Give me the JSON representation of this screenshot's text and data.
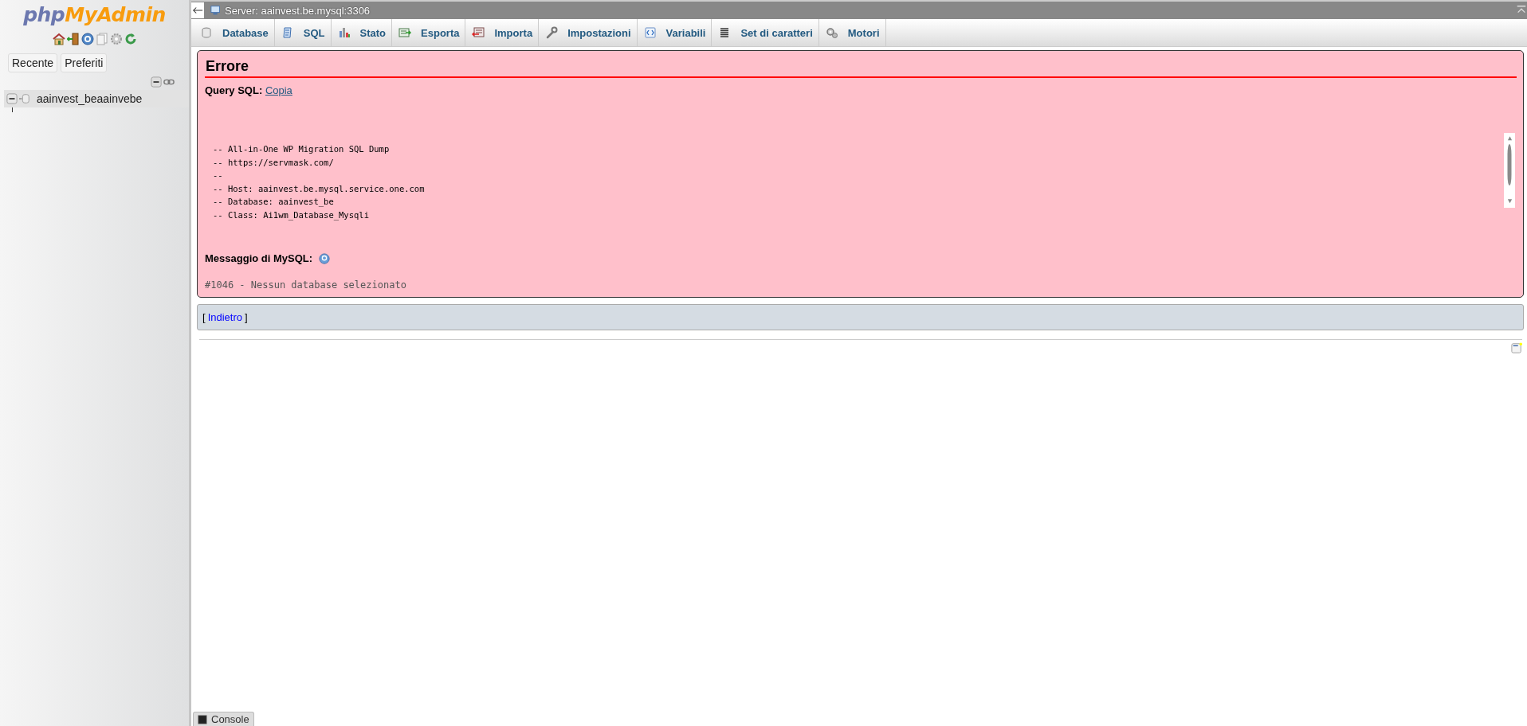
{
  "sidebar": {
    "logo": [
      "php",
      "MyAdmin"
    ],
    "buttons": [
      "Recente",
      "Preferiti"
    ],
    "tree": [
      {
        "label": "aainvest_beaainvebe",
        "expanded": true
      }
    ]
  },
  "topbar": {
    "title": "Server: aainvest.be.mysql:3306"
  },
  "tabs": [
    {
      "label": "Database",
      "kind": "database",
      "selected": false
    },
    {
      "label": "SQL",
      "kind": "sql",
      "selected": false
    },
    {
      "label": "Stato",
      "kind": "status",
      "selected": false
    },
    {
      "label": "Esporta",
      "kind": "export",
      "selected": false
    },
    {
      "label": "Importa",
      "kind": "import",
      "selected": false
    },
    {
      "label": "Impostazioni",
      "kind": "settings",
      "selected": false
    },
    {
      "label": "Variabili",
      "kind": "variables",
      "selected": false
    },
    {
      "label": "Set di caratteri",
      "kind": "charset",
      "selected": false
    },
    {
      "label": "Motori",
      "kind": "engines",
      "selected": false
    }
  ],
  "error": {
    "title": "Errore",
    "query_label": "Query SQL:",
    "copy_link": "Copia",
    "code_lines": [
      "-- All-in-One WP Migration SQL Dump",
      "-- https://servmask.com/",
      "--",
      "-- Host: aainvest.be.mysql.service.one.com",
      "-- Database: aainvest_be",
      "-- Class: Ai1wm_Database_Mysqli"
    ],
    "message_label": "Messaggio di MySQL:",
    "message": "#1046 - Nessun database selezionato"
  },
  "back": {
    "open": "[",
    "link": "Indietro",
    "close": "]"
  },
  "console": {
    "label": "Console"
  }
}
